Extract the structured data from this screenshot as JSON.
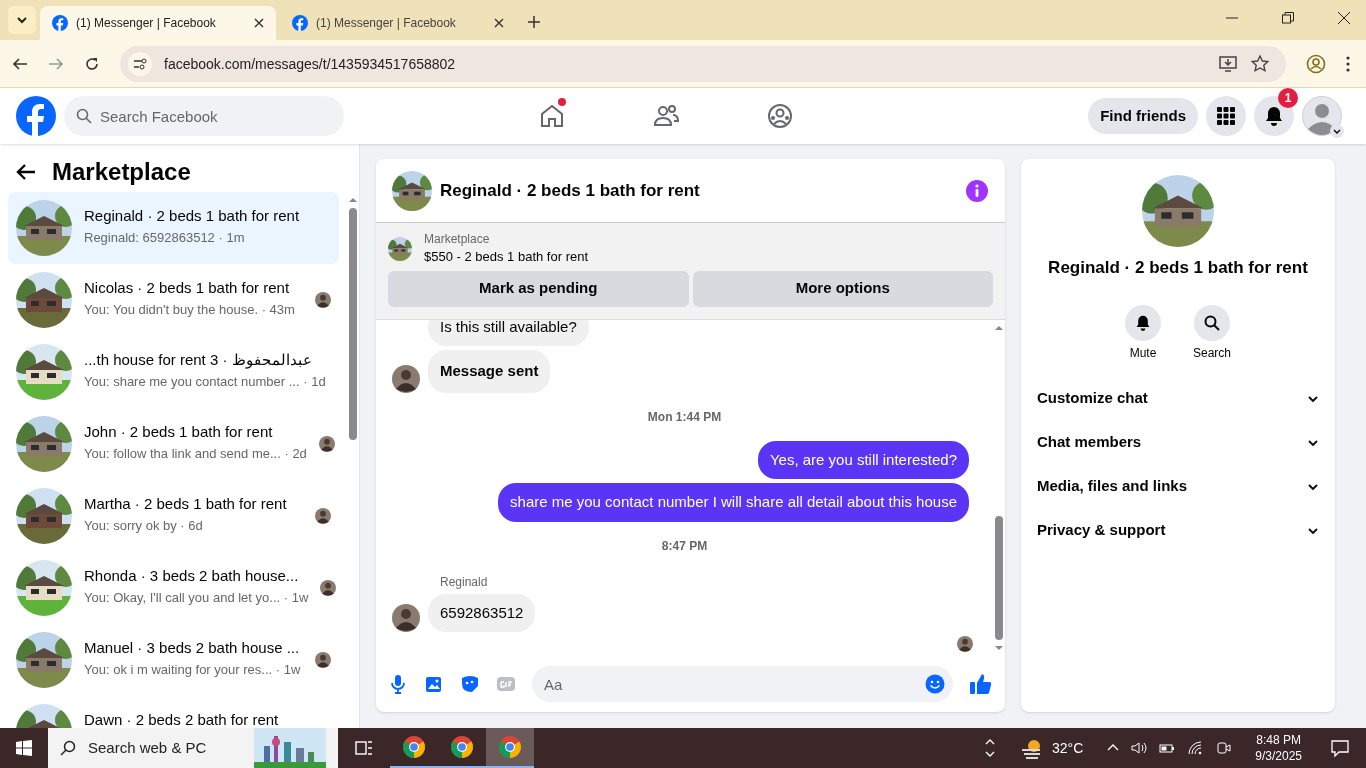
{
  "browser": {
    "tabs": [
      {
        "title": "(1) Messenger | Facebook",
        "selected": true
      },
      {
        "title": "(1) Messenger | Facebook",
        "selected": false
      }
    ],
    "url": "facebook.com/messages/t/1435934517658802"
  },
  "header": {
    "search_placeholder": "Search Facebook",
    "find_friends": "Find friends",
    "notification_count": "1"
  },
  "sidebar": {
    "title": "Marketplace",
    "conversations": [
      {
        "title": "Reginald · 2 beds 1 bath for rent",
        "snippet": "Reginald: 6592863512",
        "time": "· 1m",
        "selected": true,
        "seen": false
      },
      {
        "title": "Nicolas · 2 beds 1 bath for rent",
        "snippet": "You: You didn't buy the house.",
        "time": "· 43m",
        "selected": false,
        "seen": true
      },
      {
        "title": "...th house for rent 3 · عبدالمحفوظ",
        "snippet": "You: share me you contact number ...",
        "time": "· 1d",
        "selected": false,
        "seen": false
      },
      {
        "title": "John · 2 beds 1 bath for rent",
        "snippet": "You: follow tha link and send me...",
        "time": "· 2d",
        "selected": false,
        "seen": true
      },
      {
        "title": "Martha · 2 beds 1 bath for rent",
        "snippet": "You: sorry ok by",
        "time": "· 6d",
        "selected": false,
        "seen": true
      },
      {
        "title": "Rhonda · 3 beds 2 bath house...",
        "snippet": "You: Okay, I'll call you and let yo...",
        "time": "· 1w",
        "selected": false,
        "seen": true
      },
      {
        "title": "Manuel · 3 beds 2 bath house ...",
        "snippet": "You: ok i m waiting for your res...",
        "time": "· 1w",
        "selected": false,
        "seen": true
      },
      {
        "title": "Dawn · 2 beds 2 bath for rent",
        "selected": false,
        "seen": false
      }
    ]
  },
  "chat": {
    "title": "Reginald · 2 beds 1 bath for rent",
    "listing_label": "Marketplace",
    "listing": "$550 - 2 beds 1 bath for rent",
    "buttons": [
      "Mark as pending",
      "More options"
    ],
    "messages": [
      {
        "kind": "incoming",
        "text": "Is this still available?",
        "avatar": false
      },
      {
        "kind": "incoming",
        "text": "Message sent",
        "avatar": true
      },
      {
        "kind": "timestamp",
        "text": "Mon 1:44 PM"
      },
      {
        "kind": "outgoing",
        "text": "Yes, are you still interested?"
      },
      {
        "kind": "outgoing",
        "text": "share me you contact number I will share all detail about this house"
      },
      {
        "kind": "timestamp",
        "text": "8:47 PM"
      },
      {
        "kind": "sender",
        "text": "Reginald"
      },
      {
        "kind": "incoming",
        "text": "6592863512",
        "avatar": true
      }
    ],
    "composer_placeholder": "Aa"
  },
  "details": {
    "title": "Reginald · 2 beds 1 bath for rent",
    "actions": [
      "Mute",
      "Search"
    ],
    "sections": [
      "Customize chat",
      "Chat members",
      "Media, files and links",
      "Privacy & support"
    ]
  },
  "taskbar": {
    "search": "Search web & PC",
    "temperature": "32°C",
    "time": "8:48 PM",
    "date": "9/3/2025"
  }
}
